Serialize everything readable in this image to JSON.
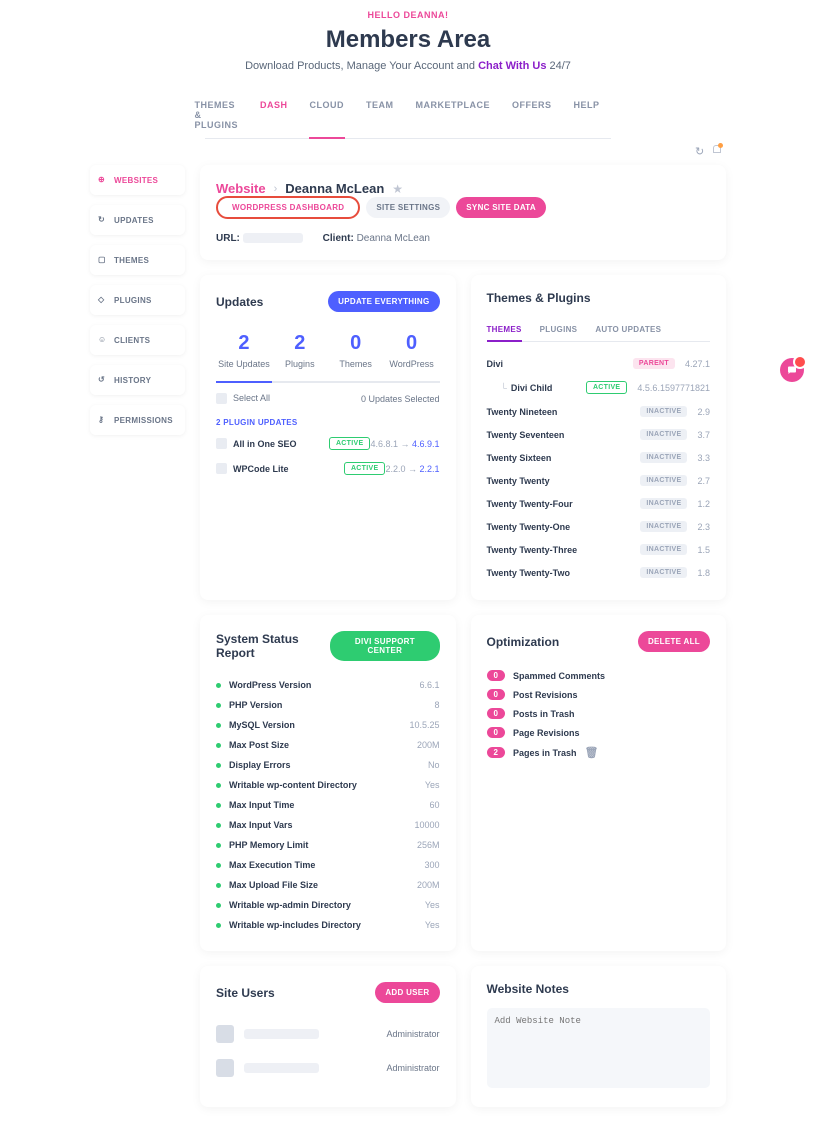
{
  "hero": {
    "hello": "HELLO DEANNA!",
    "title": "Members Area",
    "sub_pre": "Download Products, Manage Your Account and ",
    "chat": "Chat With Us",
    "sub_post": " 24/7"
  },
  "topnav": [
    "THEMES & PLUGINS",
    "DASH",
    "CLOUD",
    "TEAM",
    "MARKETPLACE",
    "OFFERS",
    "HELP"
  ],
  "sidebar": [
    {
      "label": "WEBSITES"
    },
    {
      "label": "UPDATES"
    },
    {
      "label": "THEMES"
    },
    {
      "label": "PLUGINS"
    },
    {
      "label": "CLIENTS"
    },
    {
      "label": "HISTORY"
    },
    {
      "label": "PERMISSIONS"
    }
  ],
  "site": {
    "bc_website": "Website",
    "bc_name": "Deanna McLean",
    "url_label": "URL:",
    "client_label": "Client:",
    "client_val": "Deanna McLean",
    "btn_wp": "WORDPRESS DASHBOARD",
    "btn_settings": "SITE SETTINGS",
    "btn_sync": "SYNC SITE DATA"
  },
  "updates": {
    "title": "Updates",
    "btn": "UPDATE EVERYTHING",
    "stats": [
      {
        "n": "2",
        "l": "Site Updates"
      },
      {
        "n": "2",
        "l": "Plugins"
      },
      {
        "n": "0",
        "l": "Themes"
      },
      {
        "n": "0",
        "l": "WordPress"
      }
    ],
    "select_all": "Select All",
    "selected": "0 Updates Selected",
    "heading": "2 PLUGIN UPDATES",
    "rows": [
      {
        "name": "All in One SEO",
        "status": "ACTIVE",
        "from": "4.6.8.1",
        "to": "4.6.9.1"
      },
      {
        "name": "WPCode Lite",
        "status": "ACTIVE",
        "from": "2.2.0",
        "to": "2.2.1"
      }
    ]
  },
  "tp": {
    "title": "Themes & Plugins",
    "tabs": [
      "THEMES",
      "PLUGINS",
      "AUTO UPDATES"
    ],
    "rows": [
      {
        "name": "Divi",
        "badge": "PARENT",
        "badgeClass": "b-parent",
        "ver": "4.27.1"
      },
      {
        "name": "Divi Child",
        "badge": "ACTIVE",
        "badgeClass": "b-active",
        "ver": "4.5.6.1597771821",
        "indent": true
      },
      {
        "name": "Twenty Nineteen",
        "badge": "INACTIVE",
        "badgeClass": "b-inactive",
        "ver": "2.9"
      },
      {
        "name": "Twenty Seventeen",
        "badge": "INACTIVE",
        "badgeClass": "b-inactive",
        "ver": "3.7"
      },
      {
        "name": "Twenty Sixteen",
        "badge": "INACTIVE",
        "badgeClass": "b-inactive",
        "ver": "3.3"
      },
      {
        "name": "Twenty Twenty",
        "badge": "INACTIVE",
        "badgeClass": "b-inactive",
        "ver": "2.7"
      },
      {
        "name": "Twenty Twenty-Four",
        "badge": "INACTIVE",
        "badgeClass": "b-inactive",
        "ver": "1.2"
      },
      {
        "name": "Twenty Twenty-One",
        "badge": "INACTIVE",
        "badgeClass": "b-inactive",
        "ver": "2.3"
      },
      {
        "name": "Twenty Twenty-Three",
        "badge": "INACTIVE",
        "badgeClass": "b-inactive",
        "ver": "1.5"
      },
      {
        "name": "Twenty Twenty-Two",
        "badge": "INACTIVE",
        "badgeClass": "b-inactive",
        "ver": "1.8"
      }
    ]
  },
  "status": {
    "title": "System Status Report",
    "btn": "DIVI SUPPORT CENTER",
    "rows": [
      {
        "n": "WordPress Version",
        "v": "6.6.1"
      },
      {
        "n": "PHP Version",
        "v": "8"
      },
      {
        "n": "MySQL Version",
        "v": "10.5.25"
      },
      {
        "n": "Max Post Size",
        "v": "200M"
      },
      {
        "n": "Display Errors",
        "v": "No"
      },
      {
        "n": "Writable wp-content Directory",
        "v": "Yes"
      },
      {
        "n": "Max Input Time",
        "v": "60"
      },
      {
        "n": "Max Input Vars",
        "v": "10000"
      },
      {
        "n": "PHP Memory Limit",
        "v": "256M"
      },
      {
        "n": "Max Execution Time",
        "v": "300"
      },
      {
        "n": "Max Upload File Size",
        "v": "200M"
      },
      {
        "n": "Writable wp-admin Directory",
        "v": "Yes"
      },
      {
        "n": "Writable wp-includes Directory",
        "v": "Yes"
      }
    ]
  },
  "opt": {
    "title": "Optimization",
    "btn": "DELETE ALL",
    "rows": [
      {
        "c": "0",
        "n": "Spammed Comments"
      },
      {
        "c": "0",
        "n": "Post Revisions"
      },
      {
        "c": "0",
        "n": "Posts in Trash"
      },
      {
        "c": "0",
        "n": "Page Revisions"
      },
      {
        "c": "2",
        "n": "Pages in Trash",
        "trash": true
      }
    ]
  },
  "users": {
    "title": "Site Users",
    "btn": "ADD USER",
    "rows": [
      {
        "role": "Administrator"
      },
      {
        "role": "Administrator"
      }
    ]
  },
  "notes": {
    "title": "Website Notes",
    "placeholder": "Add Website Note"
  }
}
